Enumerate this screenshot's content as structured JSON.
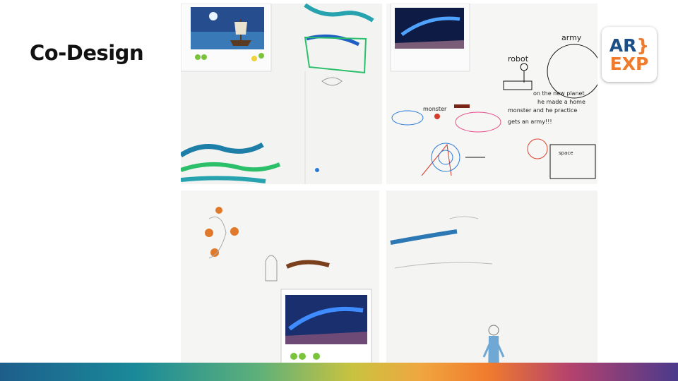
{
  "slide": {
    "title": "Co-Design"
  },
  "logo": {
    "line1": "AR",
    "bracket": "}",
    "line2": "EXP"
  },
  "photos": [
    {
      "name": "co-design-photo-ship-drawing"
    },
    {
      "name": "co-design-photo-robot-army-drawing"
    },
    {
      "name": "co-design-photo-pencil-sketch"
    },
    {
      "name": "co-design-photo-figure-drawing"
    }
  ],
  "handwriting": {
    "robot": "robot",
    "army": "army",
    "planet_note_1": "on the new planet",
    "planet_note_2": "he made a home",
    "planet_note_3": "monster and he practice",
    "planet_note_4": "gets an army!!!",
    "monster": "monster",
    "space": "space"
  }
}
